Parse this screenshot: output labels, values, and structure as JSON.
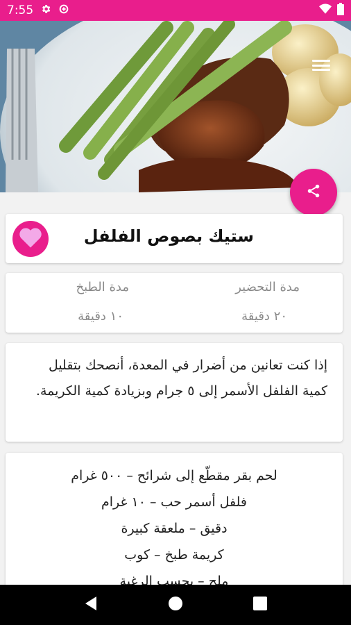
{
  "status_bar": {
    "time": "7:55"
  },
  "recipe": {
    "title": "ستيك بصوص الفلفل",
    "prep_time_label": "مدة التحضير",
    "prep_time_value": "٢٠ دقيقة",
    "cook_time_label": "مدة الطبخ",
    "cook_time_value": "١٠ دقيقة",
    "note": "إذا كنت تعانين من أضرار في المعدة، أنصحك بتقليل كمية الفلفل الأسمر إلى ٥ جرام وبزيادة كمية الكريمة.",
    "ingredients": [
      "لحم بقر مقطّع إلى شرائح – ٥٠٠ غرام",
      "فلفل أسمر حب – ١٠ غرام",
      "دقيق – ملعقة كبيرة",
      "كريمة طبخ – كوب",
      "ملح – بحسب الرغبة"
    ]
  },
  "colors": {
    "accent": "#e91e8c",
    "heart": "#f3a9e8"
  }
}
